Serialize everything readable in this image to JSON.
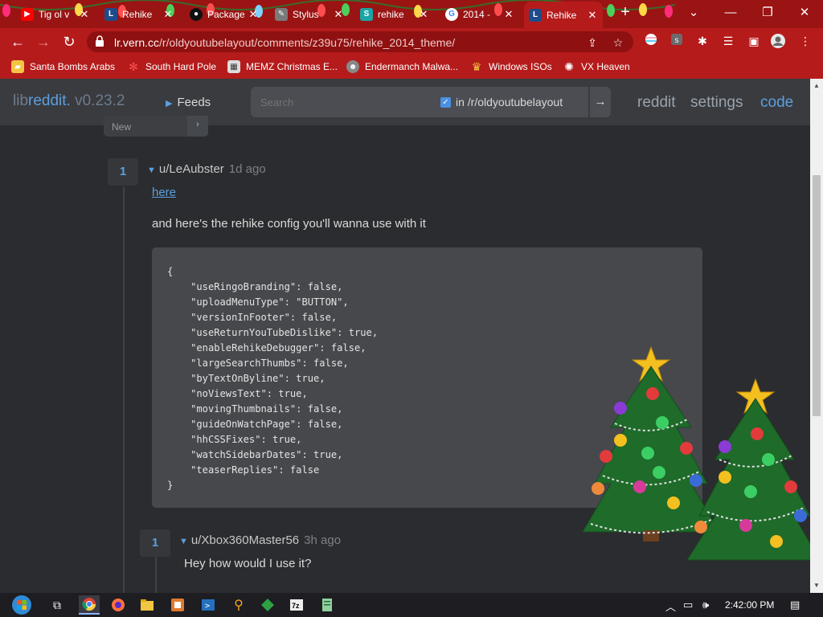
{
  "browser": {
    "tabs": [
      {
        "title": "Tig ol v",
        "icon": "youtube-icon",
        "color": "#ff0000"
      },
      {
        "title": "Rehike",
        "icon": "libreddit-icon",
        "color": "#1e4b8a"
      },
      {
        "title": "Package",
        "icon": "github-icon",
        "color": "#111111"
      },
      {
        "title": "Stylus",
        "icon": "stylus-icon",
        "color": "#7a7a7a"
      },
      {
        "title": "rehike",
        "icon": "stylus-s-icon",
        "color": "#1aa6a6"
      },
      {
        "title": "2014 -",
        "icon": "google-icon",
        "color": "#4285f4"
      },
      {
        "title": "Rehike",
        "icon": "libreddit-icon",
        "color": "#1e4b8a"
      }
    ],
    "new_tab": "+",
    "url_host": "lr.vern.cc",
    "url_path": "/r/oldyoutubelayout/comments/z39u75/rehike_2014_theme/",
    "bookmarks": [
      {
        "label": "Santa Bombs Arabs",
        "icon": "folder-icon"
      },
      {
        "label": "South Hard Pole",
        "icon": "snowflake-icon"
      },
      {
        "label": "MEMZ Christmas E...",
        "icon": "memz-icon"
      },
      {
        "label": "Endermanch Malwa...",
        "icon": "raccoon-icon"
      },
      {
        "label": "Windows ISOs",
        "icon": "windows-icon"
      },
      {
        "label": "VX Heaven",
        "icon": "virus-icon"
      }
    ]
  },
  "libreddit": {
    "brand_lib": "lib",
    "brand_reddit": "reddit.",
    "brand_version": " v0.23.2",
    "feeds_label": "Feeds",
    "search_placeholder": "Search",
    "restrict_label": "in /r/oldyoutubelayout",
    "links": {
      "reddit": "reddit",
      "settings": "settings",
      "code": "code"
    },
    "sort_value": "New"
  },
  "comments": [
    {
      "score": "1",
      "author": "u/LeAubster",
      "time": "1d ago",
      "link_text": "here",
      "body": "and here's the rehike config you'll wanna use with it",
      "code": "{\n    \"useRingoBranding\": false,\n    \"uploadMenuType\": \"BUTTON\",\n    \"versionInFooter\": false,\n    \"useReturnYouTubeDislike\": true,\n    \"enableRehikeDebugger\": false,\n    \"largeSearchThumbs\": false,\n    \"byTextOnByline\": true,\n    \"noViewsText\": true,\n    \"movingThumbnails\": false,\n    \"guideOnWatchPage\": false,\n    \"hhCSSFixes\": true,\n    \"watchSidebarDates\": true,\n    \"teaserReplies\": false\n}"
    },
    {
      "score": "1",
      "author": "u/Xbox360Master56",
      "time": "3h ago",
      "body": "Hey how would I use it?"
    }
  ],
  "taskbar": {
    "clock": "2:42:00 PM"
  },
  "colors": {
    "browser_red": "#b51b1b",
    "accent_blue": "#5c9fde",
    "page_bg": "#2b2c2f"
  }
}
